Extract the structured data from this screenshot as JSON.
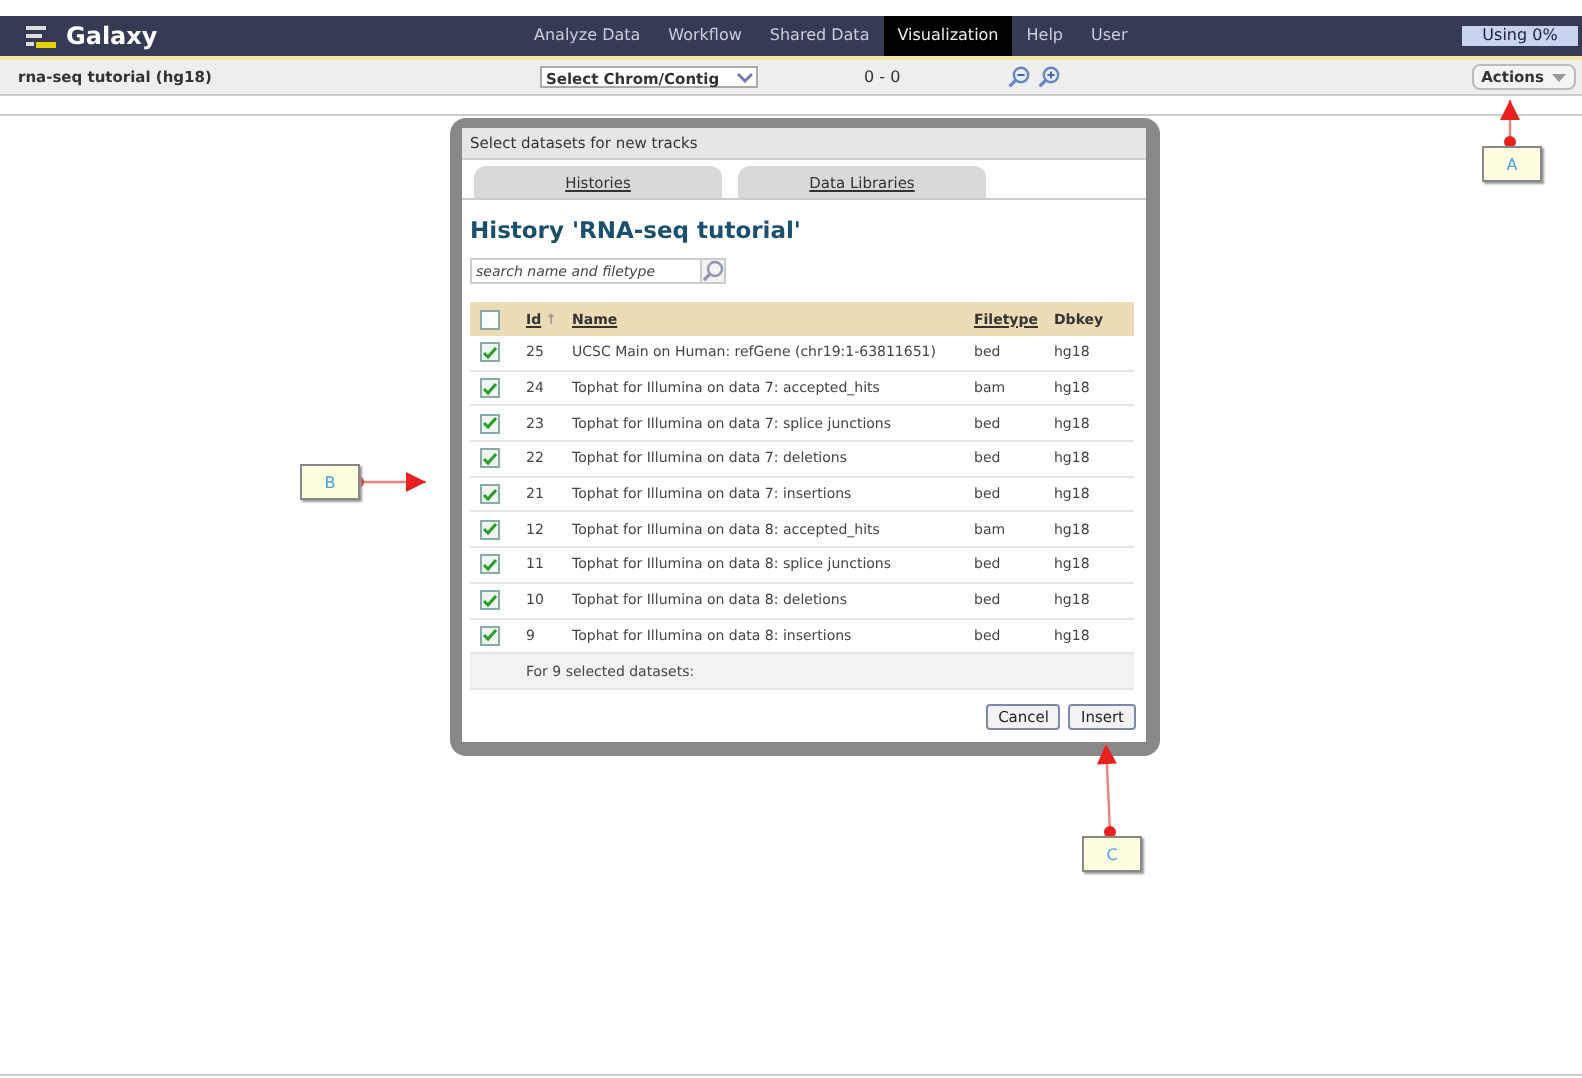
{
  "brand": "Galaxy",
  "nav": [
    {
      "label": "Analyze Data",
      "selected": false
    },
    {
      "label": "Workflow",
      "selected": false
    },
    {
      "label": "Shared Data",
      "selected": false
    },
    {
      "label": "Visualization",
      "selected": true
    },
    {
      "label": "Help",
      "selected": false
    },
    {
      "label": "User",
      "selected": false
    }
  ],
  "usage": {
    "text": "Using 0%"
  },
  "toolbar": {
    "title": "rna-seq tutorial (hg18)",
    "chrom_select": "Select Chrom/Contig",
    "range": "0 - 0",
    "actions": "Actions"
  },
  "dialog": {
    "title": "Select datasets for new tracks",
    "tabs": [
      {
        "label": "Histories"
      },
      {
        "label": "Data Libraries"
      }
    ],
    "heading": "History 'RNA-seq tutorial'",
    "search": {
      "placeholder": "search name and filetype"
    },
    "columns": [
      {
        "label": "Id",
        "sortable": true,
        "sort": "↑"
      },
      {
        "label": "Name",
        "sortable": true
      },
      {
        "label": "Filetype",
        "sortable": true
      },
      {
        "label": "Dbkey",
        "sortable": false
      }
    ],
    "all_checked": false,
    "rows": [
      {
        "id": "25",
        "name": "UCSC Main on Human: refGene (chr19:1-63811651)",
        "filetype": "bed",
        "dbkey": "hg18",
        "checked": true
      },
      {
        "id": "24",
        "name": "Tophat for Illumina on data 7: accepted_hits",
        "filetype": "bam",
        "dbkey": "hg18",
        "checked": true
      },
      {
        "id": "23",
        "name": "Tophat for Illumina on data 7: splice junctions",
        "filetype": "bed",
        "dbkey": "hg18",
        "checked": true
      },
      {
        "id": "22",
        "name": "Tophat for Illumina on data 7: deletions",
        "filetype": "bed",
        "dbkey": "hg18",
        "checked": true
      },
      {
        "id": "21",
        "name": "Tophat for Illumina on data 7: insertions",
        "filetype": "bed",
        "dbkey": "hg18",
        "checked": true
      },
      {
        "id": "12",
        "name": "Tophat for Illumina on data 8: accepted_hits",
        "filetype": "bam",
        "dbkey": "hg18",
        "checked": true
      },
      {
        "id": "11",
        "name": "Tophat for Illumina on data 8: splice junctions",
        "filetype": "bed",
        "dbkey": "hg18",
        "checked": true
      },
      {
        "id": "10",
        "name": "Tophat for Illumina on data 8: deletions",
        "filetype": "bed",
        "dbkey": "hg18",
        "checked": true
      },
      {
        "id": "9",
        "name": "Tophat for Illumina on data 8: insertions",
        "filetype": "bed",
        "dbkey": "hg18",
        "checked": true
      }
    ],
    "footer": "For 9 selected datasets:",
    "buttons": [
      "Cancel",
      "Insert"
    ]
  },
  "annotations": [
    {
      "label": "A"
    },
    {
      "label": "B"
    },
    {
      "label": "C"
    }
  ]
}
